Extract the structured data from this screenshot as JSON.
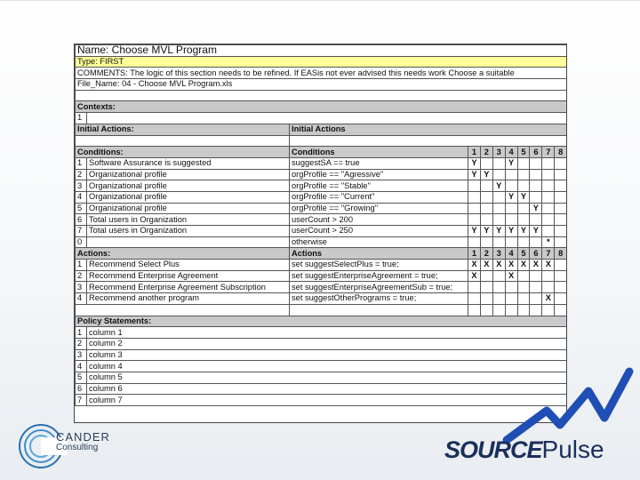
{
  "header": {
    "name": "Name: Choose MVL Program",
    "type": "Type: FIRST",
    "comments": "COMMENTS: The logic of this section needs to be refined. If EASis not ever advised this needs work Choose a suitable",
    "file_name": "File_Name: 04 - Choose MVL Program.xls"
  },
  "contexts": {
    "label": "Contexts:",
    "rows": [
      {
        "num": "1"
      }
    ]
  },
  "initial_actions": {
    "left": "Initial Actions:",
    "right": "Initial Actions"
  },
  "conditions": {
    "label": "Conditions:",
    "col_label": "Conditions",
    "col_numbers": [
      "1",
      "2",
      "3",
      "4",
      "5",
      "6",
      "7",
      "8"
    ],
    "rows": [
      {
        "num": "1",
        "text": "Software Assurance is suggested",
        "expr": "suggestSA == true",
        "marks": [
          "Y",
          "",
          "",
          "Y",
          "",
          "",
          "",
          ""
        ]
      },
      {
        "num": "2",
        "text": "Organizational profile",
        "expr": "orgProfile == \"Agressive\"",
        "marks": [
          "Y",
          "Y",
          "",
          "",
          "",
          "",
          "",
          ""
        ]
      },
      {
        "num": "3",
        "text": "Organizational profile",
        "expr": "orgProfile == \"Stable\"",
        "marks": [
          "",
          "",
          "Y",
          "",
          "",
          "",
          "",
          ""
        ]
      },
      {
        "num": "4",
        "text": "Organizational profile",
        "expr": "orgProfile == \"Current\"",
        "marks": [
          "",
          "",
          "",
          "Y",
          "Y",
          "",
          "",
          ""
        ]
      },
      {
        "num": "5",
        "text": "Organizational profile",
        "expr": "orgProfile == \"Growing\"",
        "marks": [
          "",
          "",
          "",
          "",
          "",
          "Y",
          "",
          ""
        ]
      },
      {
        "num": "6",
        "text": "Total users in Organization",
        "expr": "userCount > 200",
        "marks": [
          "",
          "",
          "",
          "",
          "",
          "",
          "",
          ""
        ]
      },
      {
        "num": "7",
        "text": "Total users in Organization",
        "expr": "userCount > 250",
        "marks": [
          "Y",
          "Y",
          "Y",
          "Y",
          "Y",
          "Y",
          "",
          ""
        ]
      },
      {
        "num": "0",
        "text": "",
        "expr": "otherwise",
        "marks": [
          "",
          "",
          "",
          "",
          "",
          "",
          "*",
          ""
        ]
      }
    ]
  },
  "actions": {
    "label": "Actions:",
    "col_label": "Actions",
    "col_numbers": [
      "1",
      "2",
      "3",
      "4",
      "5",
      "6",
      "7",
      "8"
    ],
    "rows": [
      {
        "num": "1",
        "text": "Recommend Select Plus",
        "expr": "set suggestSelectPlus = true;",
        "marks": [
          "X",
          "X",
          "X",
          "X",
          "X",
          "X",
          "X",
          ""
        ]
      },
      {
        "num": "2",
        "text": "Recommend Enterprise Agreement",
        "expr": "set suggestEnterpriseAgreement = true;",
        "marks": [
          "X",
          "",
          "",
          "X",
          "",
          "",
          "",
          ""
        ]
      },
      {
        "num": "3",
        "text": "Recommend Enterprise Agreement Subscription",
        "expr": "set suggestEnterpriseAgreementSub = true;",
        "marks": [
          "",
          "",
          "",
          "",
          "",
          "",
          "",
          ""
        ]
      },
      {
        "num": "4",
        "text": "Recommend another program",
        "expr": "set suggestOtherPrograms = true;",
        "marks": [
          "",
          "",
          "",
          "",
          "",
          "",
          "X",
          ""
        ]
      }
    ]
  },
  "policy": {
    "label": "Policy Statements:",
    "rows": [
      {
        "num": "1",
        "text": "column 1"
      },
      {
        "num": "2",
        "text": "column 2"
      },
      {
        "num": "3",
        "text": "column 3"
      },
      {
        "num": "4",
        "text": "column 4"
      },
      {
        "num": "5",
        "text": "column 5"
      },
      {
        "num": "6",
        "text": "column 6"
      },
      {
        "num": "7",
        "text": "column 7"
      }
    ]
  },
  "logos": {
    "cander_line1": "CANDER",
    "cander_line2": "Consulting",
    "sourcepulse_source": "SOURCE",
    "sourcepulse_pulse": "Pulse"
  },
  "colors": {
    "header_yellow": "#ffff99",
    "section_gray": "#c9c9c9",
    "logo_navy": "#1b2f5c",
    "pulse_blue": "#1f4fb4"
  }
}
